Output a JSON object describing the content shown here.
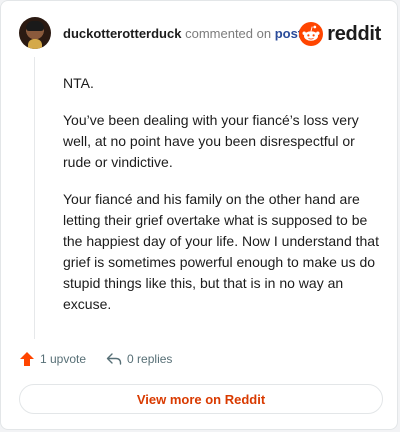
{
  "comment": {
    "author": "duckotterotterduck",
    "action_text": "commented on",
    "post_link": "post",
    "paragraphs": [
      "NTA.",
      "You’ve been dealing with your fiancé’s loss very well, at no point have you been disrespectful or rude or vindictive.",
      "Your fiancé and his family on the other hand are letting their grief overtake what is supposed to be the happiest day of your life. Now I understand that grief is sometimes powerful enough to make us do stupid things like this, but that is in no way an excuse."
    ],
    "upvotes_label": "1 upvote",
    "replies_label": "0 replies"
  },
  "brand": {
    "name": "reddit",
    "accent_color": "#ff4500"
  },
  "footer": {
    "view_more_label": "View more on Reddit"
  },
  "icons": {
    "avatar": "user-avatar",
    "logo": "reddit-logo-icon",
    "upvote": "upvote-arrow-icon",
    "reply": "reply-arrow-icon"
  }
}
